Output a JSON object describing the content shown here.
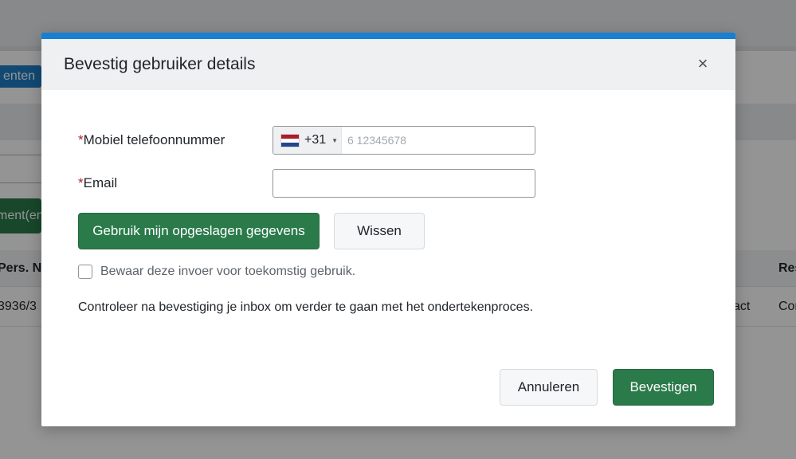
{
  "background": {
    "tab_label": "enten",
    "action_button_label": "ment(en",
    "table": {
      "header_left": "Pers. N",
      "header_right": "Res",
      "row": {
        "cell_left": "3936/3",
        "cell_mid": "act",
        "cell_right": "Cor"
      }
    }
  },
  "modal": {
    "title": "Bevestig gebruiker details",
    "close_glyph": "×",
    "phone": {
      "required_mark": "*",
      "label": "Mobiel telefoonnummer",
      "dial_code": "+31",
      "caret": "▼",
      "placeholder": "6 12345678",
      "value": ""
    },
    "email": {
      "required_mark": "*",
      "label": "Email",
      "value": ""
    },
    "use_saved_button": "Gebruik mijn opgeslagen gegevens",
    "clear_button": "Wissen",
    "remember_checkbox": {
      "checked": false,
      "label": "Bewaar deze invoer voor toekomstig gebruik."
    },
    "info_text": "Controleer na bevestiging je inbox om verder te gaan met het ondertekenproces.",
    "cancel_button": "Annuleren",
    "confirm_button": "Bevestigen"
  },
  "colors": {
    "accent_blue": "#1680d2",
    "primary_green": "#2a7a4a",
    "required_red": "#b21f2d"
  },
  "icons": {
    "close": "close-icon",
    "flag": "netherlands-flag-icon"
  }
}
